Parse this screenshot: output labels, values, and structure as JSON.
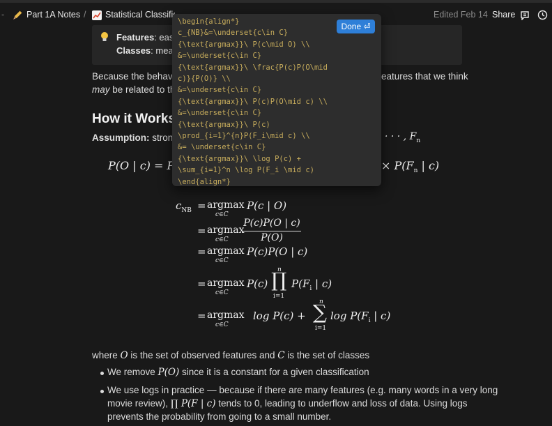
{
  "breadcrumb": {
    "parent": "Part 1A Notes",
    "separator": "/",
    "current": "Statistical Classification"
  },
  "topbar": {
    "edited": "Edited Feb 14",
    "share": "Share"
  },
  "callout": {
    "features_label": "Features",
    "features_text": ": easil",
    "classes_label": "Classes",
    "classes_text": ": mean"
  },
  "intro": {
    "line1_a": "Because the behavio",
    "line1_b": "eatures that we think",
    "line2_a": "may",
    "line2_b": " be related to the"
  },
  "section": {
    "heading": "How it Works",
    "assumption_label": "Assumption:",
    "assumption_text": " strong",
    "assumption_tail": "· · · , F",
    "assumption_tail_sub": "n"
  },
  "formula": {
    "lhs": "P(O | c) = P(",
    "rhs": "× P(F",
    "rhs_sub": "n",
    "rhs_end": " | c)"
  },
  "derivation": {
    "c_nb": "c",
    "c_nb_sub": "NB",
    "argmax": "argmax",
    "under": "c∈C",
    "l1": "P(c | O)",
    "l2_num": "P(c)P(O | c)",
    "l2_den": "P(O)",
    "l3": "P(c)P(O | c)",
    "l4_pre": "P(c)",
    "l4_post": "P(F",
    "l4_sub": "i",
    "l4_end": " | c)",
    "prod_top": "n",
    "prod_bot": "i=1",
    "l5_pre": "log P(c) +",
    "l5_post": "log P(F",
    "l5_sub": "i",
    "l5_end": " | c)",
    "sum_top": "n",
    "sum_bot": "i=1"
  },
  "explanation": {
    "where_a": "where ",
    "where_O": "O",
    "where_b": " is the set of observed features and ",
    "where_C": "C",
    "where_c": " is the set of classes",
    "b1_a": "We remove ",
    "b1_math": "P(O)",
    "b1_b": " since it is a constant for a given classification",
    "b2_l1": "We use logs in practice — because if there are many features (e.g. many words in a very long",
    "b2_l2_a": "movie review), ",
    "b2_l2_math": "∏ P(F | c)",
    "b2_l2_b": " tends to 0, leading to underflow and loss of data. Using logs",
    "b2_l3": "prevents the probability from going to a small number."
  },
  "editor": {
    "done_label": "Done ⏎",
    "source": "\\begin{align*}\nc_{NB}&=\\underset{c\\in C}\n{\\text{argmax}}\\ P(c\\mid O) \\\\\n&=\\underset{c\\in C}\n{\\text{argmax}}\\ \\frac{P(c)P(O\\mid\nc)}{P(O)} \\\\\n&=\\underset{c\\in C}\n{\\text{argmax}}\\ P(c)P(O\\mid c) \\\\\n&=\\underset{c\\in C}\n{\\text{argmax}}\\ P(c)\n\\prod_{i=1}^{n}P(F_i\\mid c) \\\\\n&= \\underset{c\\in C}\n{\\text{argmax}}\\ \\log P(c) +\n\\sum_{i=1}^n \\log P(F_i \\mid c)\n\\end{align*}"
  },
  "colors": {
    "background": "#191919",
    "accent": "#2e7fd8",
    "code": "#c8ad5c"
  }
}
